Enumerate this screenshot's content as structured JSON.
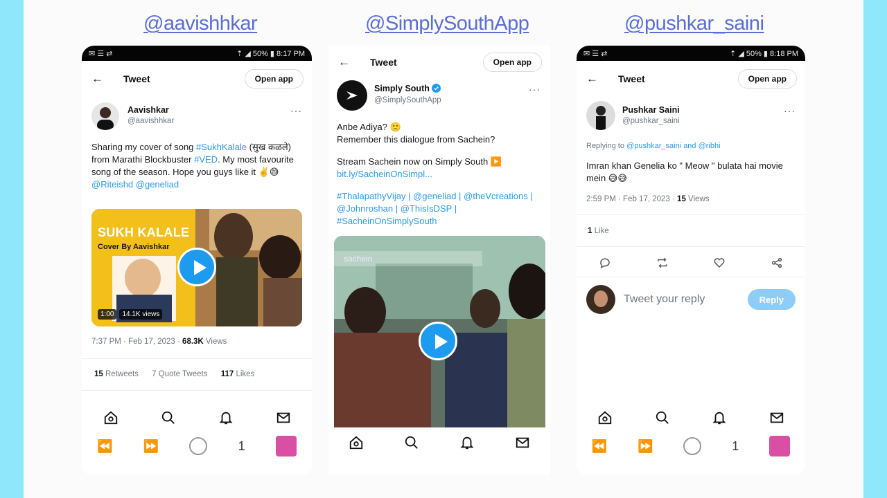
{
  "handles": [
    "@aavishhkar",
    "@SimplySouthApp",
    "@pushkar_saini"
  ],
  "common": {
    "tweet_title": "Tweet",
    "open_app": "Open app",
    "back_arrow": "←",
    "more": "···"
  },
  "phone1": {
    "status_left": "✉ ☰ ⇄",
    "status_right": "⇡ ◢ 50% ▮ 8:17 PM",
    "author_name": "Aavishkar",
    "author_handle": "@aavishhkar",
    "text_lines": [
      "Sharing my cover of song ",
      "#SukhKalale",
      " (सुख कळले) from Marathi Blockbuster ",
      "#VED",
      ". My most favourite song of the season. Hope you guys like it ✌️😅"
    ],
    "mentions": "@Riteishd @geneliad",
    "thumb_title": "SUKH KALALE",
    "thumb_subtitle": "Cover By Aavishkar",
    "thumb_duration": "1:00",
    "thumb_views": "14.1K views",
    "time_date": "7:37 PM · Feb 17, 2023 · ",
    "views_count": "68.3K",
    "views_label": " Views",
    "retweets_count": "15",
    "retweets_label": " Retweets",
    "quote_label": "7 Quote Tweets",
    "likes_count": "117",
    "likes_label": " Likes",
    "sys_page": "1"
  },
  "phone2": {
    "author_name": "Simply South",
    "author_handle": "@SimplySouthApp",
    "line1": "Anbe Adiya? 🙁",
    "line2": "Remember this dialogue from Sachein?",
    "line3": "Stream Sachein now on Simply South ▶️",
    "link1": "bit.ly/SacheinOnSimpl...",
    "tags": "#ThalapathyVijay | @geneliad | @theVcreations | @Johnroshan | @ThisIsDSP | #SacheinOnSimplySouth",
    "video_caption": "sachein"
  },
  "phone3": {
    "status_left": "✉ ☰ ⇄",
    "status_right": "⇡ ◢ 50% ▮ 8:18 PM",
    "author_name": "Pushkar Saini",
    "author_handle": "@pushkar_saini",
    "replying_prefix": "Replying to ",
    "replying_to": "@pushkar_saini and @ribhi",
    "text": "Imran khan Genelia ko \" Meow \" bulata hai movie mein 😅😅",
    "time_date": "2:59 PM · Feb 17, 2023 · ",
    "views_count": "15",
    "views_label": " Views",
    "likes_count": "1",
    "likes_label": " Like",
    "reply_placeholder": "Tweet your reply",
    "reply_button": "Reply",
    "sys_page": "1"
  },
  "colors": {
    "background": "#8ee7fb",
    "accent": "#1d9bf0",
    "handle": "#5a6ed1",
    "link": "#2a9ae8"
  }
}
